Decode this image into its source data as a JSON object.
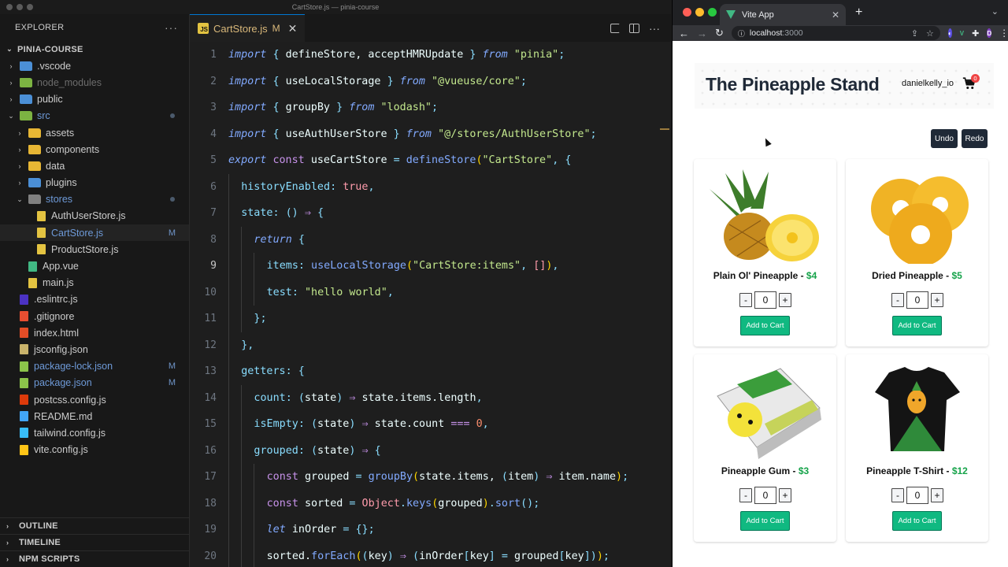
{
  "vscode": {
    "title": "CartStore.js — pinia-course",
    "sidebar_title": "EXPLORER",
    "more_icon": "ellipsis-icon",
    "project_name": "PINIA-COURSE",
    "tree": [
      {
        "label": ".vscode",
        "kind": "folder",
        "color": "#4b8fd6",
        "state": "normal"
      },
      {
        "label": "node_modules",
        "kind": "folder",
        "color": "#7cb342",
        "state": "dim"
      },
      {
        "label": "public",
        "kind": "folder",
        "color": "#4b8fd6",
        "state": "normal"
      },
      {
        "label": "src",
        "kind": "folder",
        "color": "#7cb342",
        "state": "modified"
      },
      {
        "label": "assets",
        "kind": "folder",
        "color": "#e7b634",
        "state": "normal"
      },
      {
        "label": "components",
        "kind": "folder",
        "color": "#e7b634",
        "state": "normal"
      },
      {
        "label": "data",
        "kind": "folder",
        "color": "#e7b634",
        "state": "normal"
      },
      {
        "label": "plugins",
        "kind": "folder",
        "color": "#4b8fd6",
        "state": "normal"
      },
      {
        "label": "stores",
        "kind": "folder",
        "color": "#808080",
        "state": "modified"
      },
      {
        "label": "AuthUserStore.js",
        "kind": "file",
        "color": "#e3c341",
        "state": "normal"
      },
      {
        "label": "CartStore.js",
        "kind": "file",
        "color": "#e3c341",
        "state": "modified-selected",
        "badge": "M"
      },
      {
        "label": "ProductStore.js",
        "kind": "file",
        "color": "#e3c341",
        "state": "normal"
      },
      {
        "label": "App.vue",
        "kind": "file",
        "color": "#41b883",
        "state": "normal"
      },
      {
        "label": "main.js",
        "kind": "file",
        "color": "#e3c341",
        "state": "normal"
      },
      {
        "label": ".eslintrc.js",
        "kind": "file",
        "color": "#4b32c3",
        "state": "normal"
      },
      {
        "label": ".gitignore",
        "kind": "file",
        "color": "#e84e31",
        "state": "normal"
      },
      {
        "label": "index.html",
        "kind": "file",
        "color": "#e44d26",
        "state": "normal"
      },
      {
        "label": "jsconfig.json",
        "kind": "file",
        "color": "#c9b36b",
        "state": "normal"
      },
      {
        "label": "package-lock.json",
        "kind": "file",
        "color": "#8bc34a",
        "state": "modified",
        "badge": "M"
      },
      {
        "label": "package.json",
        "kind": "file",
        "color": "#8bc34a",
        "state": "modified",
        "badge": "M"
      },
      {
        "label": "postcss.config.js",
        "kind": "file",
        "color": "#dd3a0a",
        "state": "normal"
      },
      {
        "label": "README.md",
        "kind": "file",
        "color": "#42a5f5",
        "state": "normal"
      },
      {
        "label": "tailwind.config.js",
        "kind": "file",
        "color": "#38bdf8",
        "state": "normal"
      },
      {
        "label": "vite.config.js",
        "kind": "file",
        "color": "#ffc517",
        "state": "normal"
      }
    ],
    "bottom_panels": [
      "OUTLINE",
      "TIMELINE",
      "NPM SCRIPTS"
    ],
    "tab": {
      "label": "CartStore.js",
      "status": "M",
      "icon": "js-file-icon",
      "close": "✕"
    },
    "current_line": 9,
    "code_lines": [
      {
        "n": "1",
        "indent": 0,
        "tokens": [
          [
            "kw",
            "import "
          ],
          [
            "pun",
            "{ "
          ],
          [
            "plain",
            "defineStore, acceptHMRUpdate "
          ],
          [
            "pun",
            "} "
          ],
          [
            "kw",
            "from "
          ],
          [
            "str",
            "\"pinia\""
          ],
          [
            "pun",
            ";"
          ]
        ]
      },
      {
        "n": "2",
        "indent": 0,
        "tokens": [
          [
            "kw",
            "import "
          ],
          [
            "pun",
            "{ "
          ],
          [
            "plain",
            "useLocalStorage "
          ],
          [
            "pun",
            "} "
          ],
          [
            "kw",
            "from "
          ],
          [
            "str",
            "\"@vueuse/core\""
          ],
          [
            "pun",
            ";"
          ]
        ]
      },
      {
        "n": "3",
        "indent": 0,
        "tokens": [
          [
            "kw",
            "import "
          ],
          [
            "pun",
            "{ "
          ],
          [
            "plain",
            "groupBy "
          ],
          [
            "pun",
            "} "
          ],
          [
            "kw",
            "from "
          ],
          [
            "str",
            "\"lodash\""
          ],
          [
            "pun",
            ";"
          ]
        ]
      },
      {
        "n": "4",
        "indent": 0,
        "tokens": [
          [
            "kw",
            "import "
          ],
          [
            "pun",
            "{ "
          ],
          [
            "plain",
            "useAuthUserStore "
          ],
          [
            "pun",
            "} "
          ],
          [
            "kw",
            "from "
          ],
          [
            "str",
            "\"@/stores/AuthUserStore\""
          ],
          [
            "pun",
            ";"
          ]
        ]
      },
      {
        "n": "5",
        "indent": 0,
        "tokens": [
          [
            "kw",
            "export "
          ],
          [
            "op",
            "const "
          ],
          [
            "plain",
            "useCartStore "
          ],
          [
            "pun",
            "= "
          ],
          [
            "fn",
            "defineStore"
          ],
          [
            "brk",
            "("
          ],
          [
            "str",
            "\"CartStore\""
          ],
          [
            "pun",
            ", "
          ],
          [
            "pun",
            "{"
          ]
        ]
      },
      {
        "n": "6",
        "indent": 1,
        "tokens": [
          [
            "prop",
            "historyEnabled"
          ],
          [
            "pun",
            ": "
          ],
          [
            "bool",
            "true"
          ],
          [
            "pun",
            ","
          ]
        ]
      },
      {
        "n": "7",
        "indent": 1,
        "tokens": [
          [
            "prop",
            "state"
          ],
          [
            "pun",
            ": "
          ],
          [
            "pun",
            "() "
          ],
          [
            "op",
            "⇒ "
          ],
          [
            "pun",
            "{"
          ]
        ]
      },
      {
        "n": "8",
        "indent": 2,
        "tokens": [
          [
            "kw",
            "return "
          ],
          [
            "pun",
            "{"
          ]
        ]
      },
      {
        "n": "9",
        "indent": 3,
        "tokens": [
          [
            "prop",
            "items"
          ],
          [
            "pun",
            ": "
          ],
          [
            "fn",
            "useLocalStorage"
          ],
          [
            "brk",
            "("
          ],
          [
            "str",
            "\"CartStore:items\""
          ],
          [
            "pun",
            ", "
          ],
          [
            "bool",
            "[]"
          ],
          [
            "brk",
            ")"
          ],
          [
            "pun",
            ","
          ]
        ]
      },
      {
        "n": "10",
        "indent": 3,
        "tokens": [
          [
            "prop",
            "test"
          ],
          [
            "pun",
            ": "
          ],
          [
            "str",
            "\"hello world\""
          ],
          [
            "pun",
            ","
          ]
        ]
      },
      {
        "n": "11",
        "indent": 2,
        "tokens": [
          [
            "pun",
            "};"
          ]
        ]
      },
      {
        "n": "12",
        "indent": 1,
        "tokens": [
          [
            "pun",
            "},"
          ]
        ]
      },
      {
        "n": "13",
        "indent": 1,
        "tokens": [
          [
            "prop",
            "getters"
          ],
          [
            "pun",
            ": "
          ],
          [
            "pun",
            "{"
          ]
        ]
      },
      {
        "n": "14",
        "indent": 2,
        "tokens": [
          [
            "prop",
            "count"
          ],
          [
            "pun",
            ": "
          ],
          [
            "pun",
            "("
          ],
          [
            "plain",
            "state"
          ],
          [
            "pun",
            ") "
          ],
          [
            "op",
            "⇒ "
          ],
          [
            "plain",
            "state.items.length"
          ],
          [
            "pun",
            ","
          ]
        ]
      },
      {
        "n": "15",
        "indent": 2,
        "tokens": [
          [
            "prop",
            "isEmpty"
          ],
          [
            "pun",
            ": "
          ],
          [
            "pun",
            "("
          ],
          [
            "plain",
            "state"
          ],
          [
            "pun",
            ") "
          ],
          [
            "op",
            "⇒ "
          ],
          [
            "plain",
            "state.count "
          ],
          [
            "op",
            "=== "
          ],
          [
            "num",
            "0"
          ],
          [
            "pun",
            ","
          ]
        ]
      },
      {
        "n": "16",
        "indent": 2,
        "tokens": [
          [
            "prop",
            "grouped"
          ],
          [
            "pun",
            ": "
          ],
          [
            "pun",
            "("
          ],
          [
            "plain",
            "state"
          ],
          [
            "pun",
            ") "
          ],
          [
            "op",
            "⇒ "
          ],
          [
            "pun",
            "{"
          ]
        ]
      },
      {
        "n": "17",
        "indent": 3,
        "tokens": [
          [
            "op",
            "const "
          ],
          [
            "plain",
            "grouped "
          ],
          [
            "pun",
            "= "
          ],
          [
            "fn",
            "groupBy"
          ],
          [
            "brk",
            "("
          ],
          [
            "plain",
            "state.items, "
          ],
          [
            "pun",
            "("
          ],
          [
            "plain",
            "item"
          ],
          [
            "pun",
            ") "
          ],
          [
            "op",
            "⇒ "
          ],
          [
            "plain",
            "item.name"
          ],
          [
            "brk",
            ")"
          ],
          [
            "pun",
            ";"
          ]
        ]
      },
      {
        "n": "18",
        "indent": 3,
        "tokens": [
          [
            "op",
            "const "
          ],
          [
            "plain",
            "sorted "
          ],
          [
            "pun",
            "= "
          ],
          [
            "bool",
            "Object"
          ],
          [
            "pun",
            "."
          ],
          [
            "fn",
            "keys"
          ],
          [
            "brk",
            "("
          ],
          [
            "plain",
            "grouped"
          ],
          [
            "brk",
            ")"
          ],
          [
            "pun",
            "."
          ],
          [
            "fn",
            "sort"
          ],
          [
            "pun",
            "();"
          ]
        ]
      },
      {
        "n": "19",
        "indent": 3,
        "tokens": [
          [
            "kw",
            "let "
          ],
          [
            "plain",
            "inOrder "
          ],
          [
            "pun",
            "= "
          ],
          [
            "pun",
            "{};"
          ]
        ]
      },
      {
        "n": "20",
        "indent": 3,
        "tokens": [
          [
            "plain",
            "sorted."
          ],
          [
            "fn",
            "forEach"
          ],
          [
            "brk",
            "("
          ],
          [
            "pun",
            "("
          ],
          [
            "plain",
            "key"
          ],
          [
            "pun",
            ") "
          ],
          [
            "op",
            "⇒ "
          ],
          [
            "pun",
            "("
          ],
          [
            "plain",
            "inOrder"
          ],
          [
            "pun",
            "["
          ],
          [
            "plain",
            "key"
          ],
          [
            "pun",
            "] "
          ],
          [
            "pun",
            "= "
          ],
          [
            "plain",
            "grouped"
          ],
          [
            "pun",
            "["
          ],
          [
            "plain",
            "key"
          ],
          [
            "pun",
            "]"
          ],
          [
            "pun",
            ")"
          ],
          [
            "brk",
            ")"
          ],
          [
            "pun",
            ";"
          ]
        ]
      }
    ]
  },
  "browser": {
    "tab_title": "Vite App",
    "tab_close": "✕",
    "new_tab": "+",
    "url_host": "localhost",
    "url_port": ":3000",
    "site": {
      "title": "The Pineapple Stand",
      "user": "danielkelly_io",
      "cart_count": "0",
      "undo_label": "Undo",
      "redo_label": "Redo"
    },
    "products": [
      {
        "name": "Plain Ol' Pineapple - ",
        "price": "$4",
        "qty": "0",
        "image": "pineapple-image"
      },
      {
        "name": "Dried Pineapple - ",
        "price": "$5",
        "qty": "0",
        "image": "dried-pineapple-image"
      },
      {
        "name": "Pineapple Gum - ",
        "price": "$3",
        "qty": "0",
        "image": "pineapple-gum-image"
      },
      {
        "name": "Pineapple T-Shirt - ",
        "price": "$12",
        "qty": "0",
        "image": "pineapple-tshirt-image"
      }
    ],
    "minus_label": "-",
    "plus_label": "+",
    "add_to_cart_label": "Add to Cart"
  }
}
